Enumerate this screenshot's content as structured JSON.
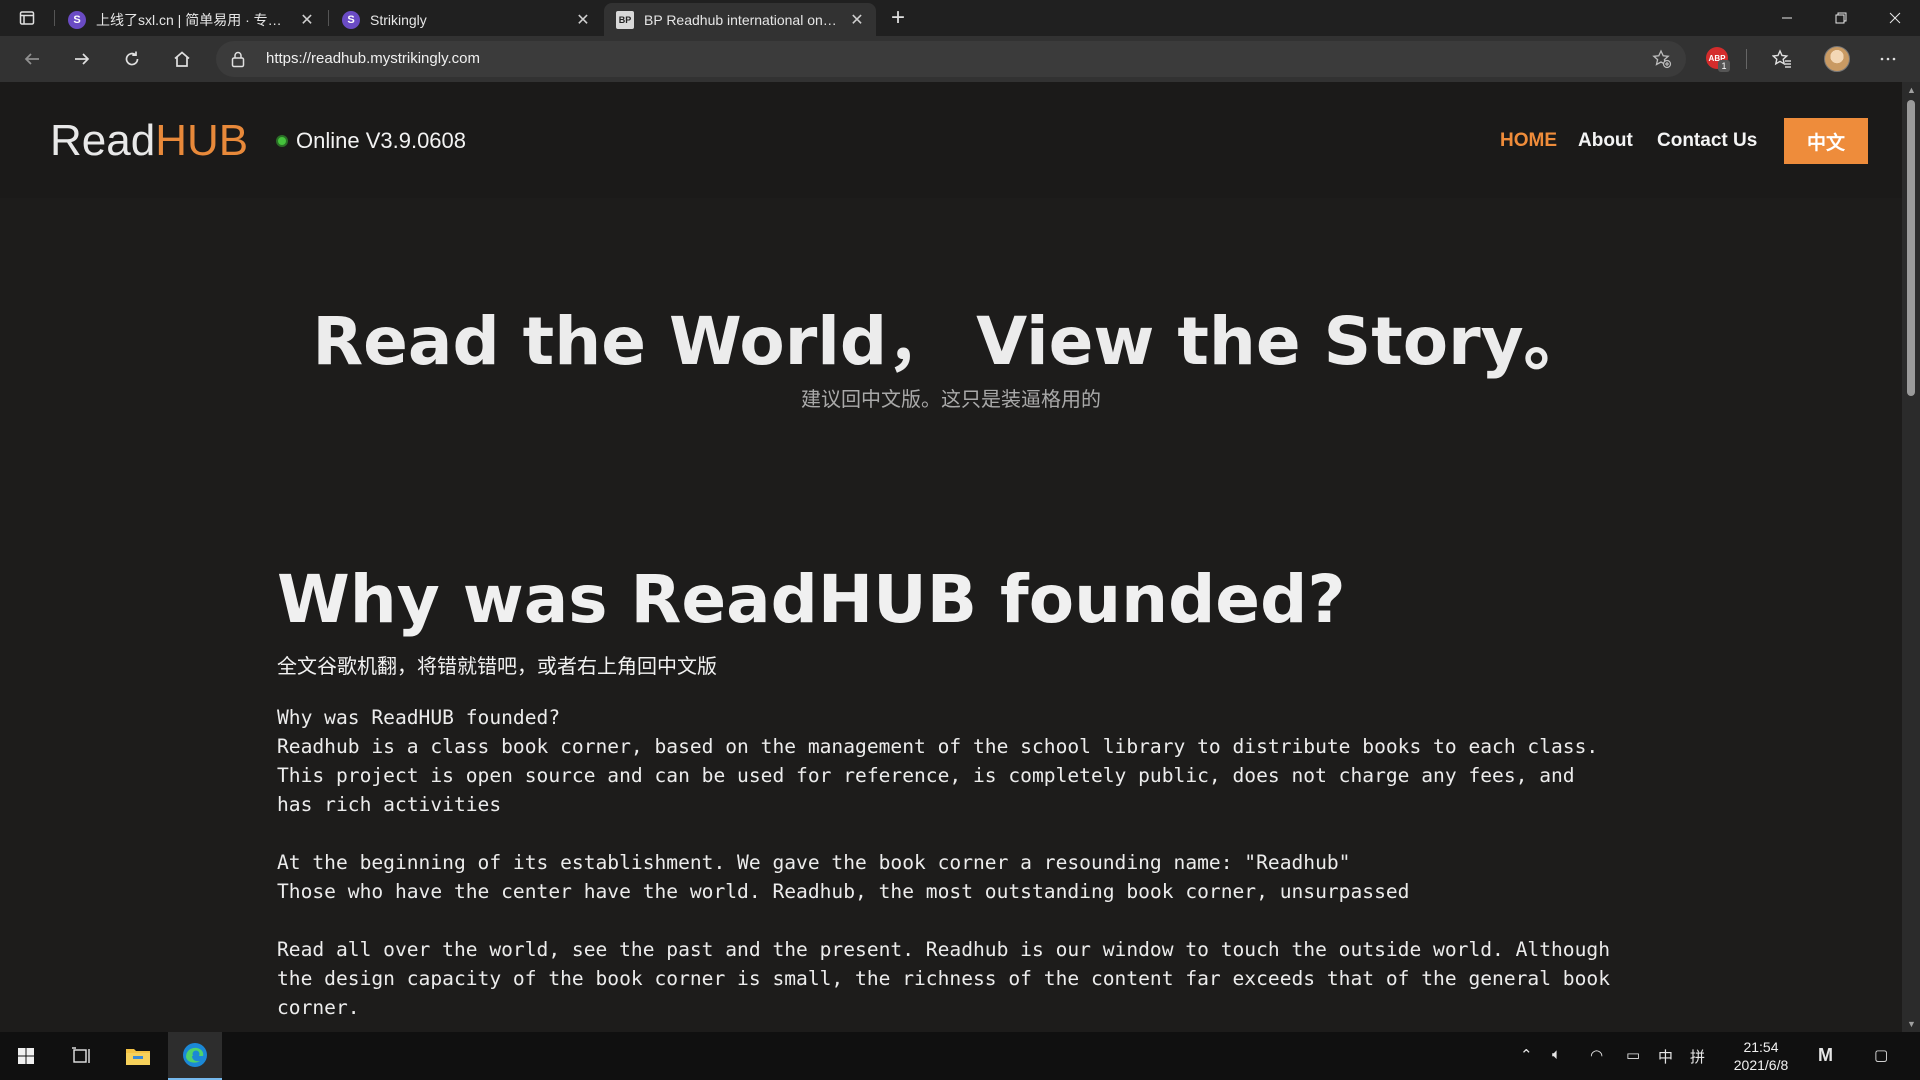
{
  "browser": {
    "tabs": [
      {
        "title": "上线了sxl.cn | 简单易用 · 专业美",
        "favicon": "S",
        "active": false
      },
      {
        "title": "Strikingly",
        "favicon": "S",
        "active": false
      },
      {
        "title": "BP Readhub international on Strikingly",
        "favicon": "BP",
        "active": true
      }
    ],
    "url": "https://readhub.mystrikingly.com",
    "extension_badge": "1",
    "extension_label": "ABP"
  },
  "site": {
    "logo_read": "Read",
    "logo_hub": "HUB",
    "status": "Online V3.9.0608",
    "nav": {
      "home": "HOME",
      "about": "About",
      "contact": "Contact Us",
      "lang": "中文"
    },
    "hero": {
      "title": "Read the World， View the Story。",
      "subtitle": "建议回中文版。这只是装逼格用的"
    },
    "section": {
      "heading": "Why was ReadHUB founded?",
      "note": "全文谷歌机翻，将错就错吧，或者右上角回中文版",
      "paragraphs": [
        [
          "Why was ReadHUB founded?",
          "Readhub is a class book corner, based on the management of the school library to distribute books to each class. This project is open source and can be used for reference, is completely public, does not charge any fees, and has rich activities"
        ],
        [
          "At the beginning of its establishment. We gave the book corner a resounding name: \"Readhub\"",
          "Those who have the center have the world. Readhub, the most outstanding book corner, unsurpassed"
        ],
        [
          "Read all over the world, see the past and the present. Readhub is our window to touch the outside world. Although the design capacity of the book corner is small, the richness of the content far exceeds that of the general book corner."
        ]
      ]
    }
  },
  "taskbar": {
    "time": "21:54",
    "date": "2021/6/8",
    "ime": "中",
    "ime_mode": "拼"
  },
  "colors": {
    "accent": "#ee8c3b",
    "status_dot": "#45c23c",
    "page_bg": "#1d1c1b"
  }
}
